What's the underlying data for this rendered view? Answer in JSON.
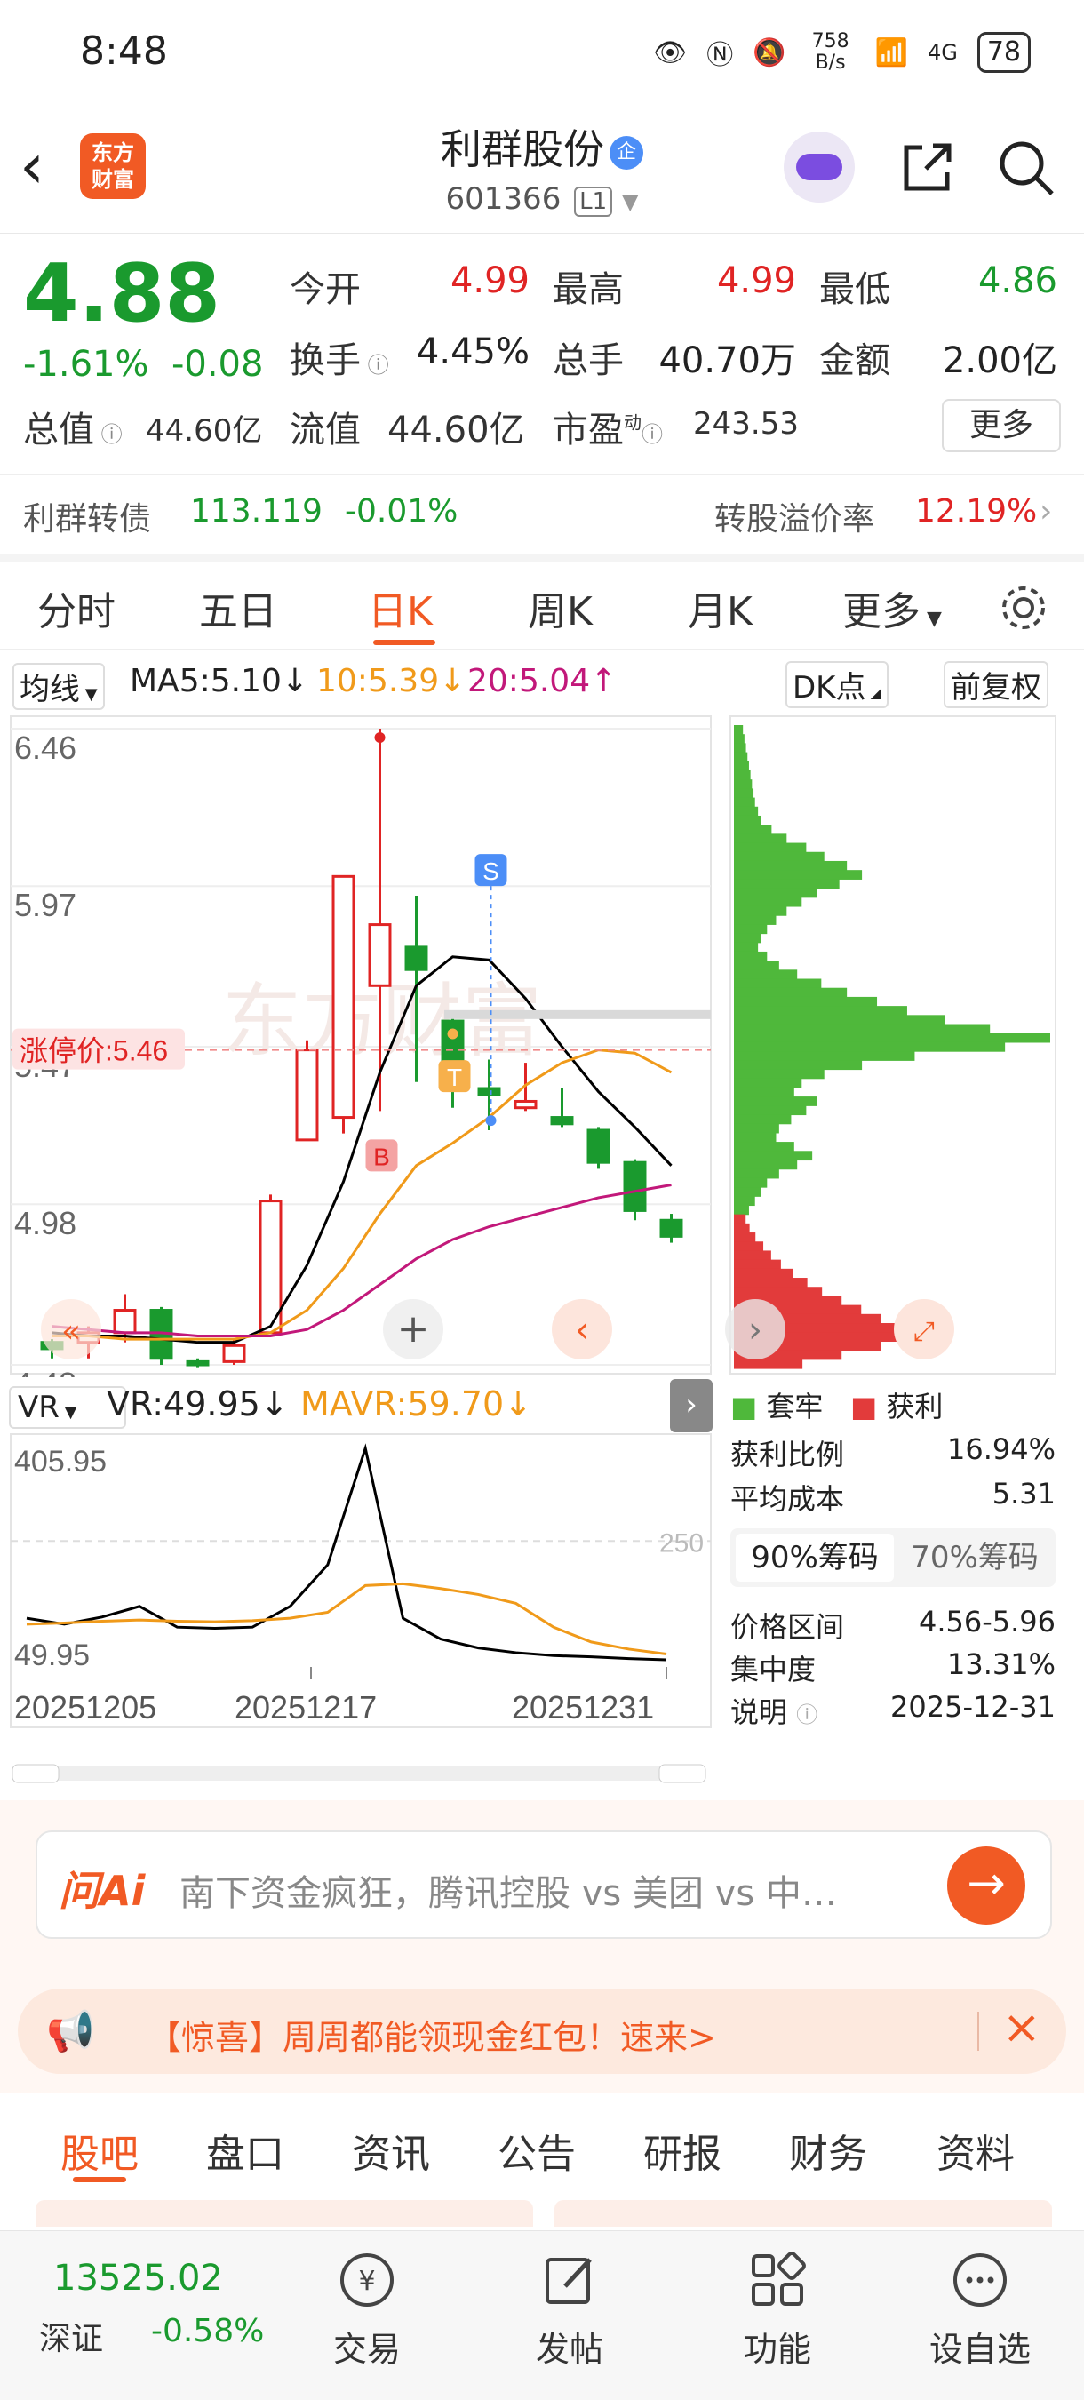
{
  "status_bar": {
    "time": "8:48",
    "net_speed": "758 B/s",
    "signal": "4G",
    "battery": "78"
  },
  "header": {
    "logo_line1": "东方",
    "logo_line2": "财富",
    "stock_name": "利群股份",
    "badge": "企",
    "stock_code": "601366",
    "level_tag": "L1"
  },
  "quote": {
    "price": "4.88",
    "change_pct": "-1.61%",
    "change": "-0.08",
    "open_label": "今开",
    "open": "4.99",
    "high_label": "最高",
    "high": "4.99",
    "low_label": "最低",
    "low": "4.86",
    "turnover_label": "换手",
    "turnover": "4.45%",
    "volume_label": "总手",
    "volume": "40.70万",
    "amount_label": "金额",
    "amount": "2.00亿",
    "mktcap_label": "总值",
    "mktcap": "44.60亿",
    "float_label": "流值",
    "float_cap": "44.60亿",
    "pe_label": "市盈",
    "pe_sup": "动",
    "pe": "243.53",
    "more_label": "更多"
  },
  "bond": {
    "name": "利群转债",
    "price": "113.119",
    "change": "-0.01%",
    "premium_label": "转股溢价率",
    "premium": "12.19%"
  },
  "tabs": [
    "分时",
    "五日",
    "日K",
    "周K",
    "月K",
    "更多"
  ],
  "active_tab": "日K",
  "indicators": {
    "ma_selector": "均线",
    "ma5": "MA5:5.10↓",
    "ma10": "10:5.39↓",
    "ma20": "20:5.04↑",
    "dk_label": "DK点",
    "adjust_label": "前复权"
  },
  "chart_data": [
    {
      "type": "candlestick",
      "price_axis_ticks": [
        "6.46",
        "5.97",
        "5.47",
        "4.98",
        "4.48"
      ],
      "ylim": [
        4.48,
        6.46
      ],
      "limit_up_label": "涨停价:5.46",
      "limit_up_value": 5.46,
      "markers": [
        "B",
        "T",
        "S"
      ],
      "candles": [
        {
          "open": 4.55,
          "high": 4.56,
          "low": 4.5,
          "close": 4.53
        },
        {
          "open": 4.55,
          "high": 4.6,
          "low": 4.5,
          "close": 4.58
        },
        {
          "open": 4.58,
          "high": 4.7,
          "low": 4.55,
          "close": 4.65
        },
        {
          "open": 4.65,
          "high": 4.66,
          "low": 4.48,
          "close": 4.5
        },
        {
          "open": 4.49,
          "high": 4.5,
          "low": 4.47,
          "close": 4.48
        },
        {
          "open": 4.49,
          "high": 4.56,
          "low": 4.48,
          "close": 4.54
        },
        {
          "open": 4.58,
          "high": 5.01,
          "low": 4.58,
          "close": 4.99
        },
        {
          "open": 5.18,
          "high": 5.49,
          "low": 5.18,
          "close": 5.46
        },
        {
          "open": 5.25,
          "high": 6.0,
          "low": 5.2,
          "close": 6.0
        },
        {
          "open": 5.66,
          "high": 6.46,
          "low": 5.27,
          "close": 5.85
        },
        {
          "open": 5.78,
          "high": 5.94,
          "low": 5.36,
          "close": 5.71
        },
        {
          "open": 5.55,
          "high": 5.57,
          "low": 5.28,
          "close": 5.37
        },
        {
          "open": 5.34,
          "high": 5.43,
          "low": 5.21,
          "close": 5.32
        },
        {
          "open": 5.28,
          "high": 5.42,
          "low": 5.27,
          "close": 5.3
        },
        {
          "open": 5.25,
          "high": 5.34,
          "low": 5.22,
          "close": 5.23
        },
        {
          "open": 5.21,
          "high": 5.22,
          "low": 5.09,
          "close": 5.11
        },
        {
          "open": 5.11,
          "high": 5.12,
          "low": 4.93,
          "close": 4.96
        },
        {
          "open": 4.93,
          "high": 4.95,
          "low": 4.86,
          "close": 4.88
        }
      ],
      "series": [
        {
          "name": "MA5",
          "color": "#000000",
          "values": [
            4.58,
            4.57,
            4.57,
            4.56,
            4.55,
            4.55,
            4.6,
            4.79,
            5.05,
            5.39,
            5.66,
            5.75,
            5.74,
            5.62,
            5.47,
            5.33,
            5.22,
            5.1
          ]
        },
        {
          "name": "10",
          "color": "#f09a1a",
          "values": [
            4.57,
            4.57,
            4.56,
            4.56,
            4.56,
            4.56,
            4.58,
            4.65,
            4.78,
            4.95,
            5.1,
            5.17,
            5.25,
            5.35,
            5.42,
            5.46,
            5.45,
            5.39
          ]
        },
        {
          "name": "20",
          "color": "#c2187a",
          "values": [
            4.6,
            4.59,
            4.58,
            4.58,
            4.57,
            4.57,
            4.57,
            4.59,
            4.65,
            4.73,
            4.81,
            4.87,
            4.91,
            4.94,
            4.97,
            5.0,
            5.02,
            5.04
          ]
        }
      ]
    },
    {
      "type": "line",
      "ylim": [
        49.95,
        405.95
      ],
      "yticks": [
        "405.95",
        "49.95"
      ],
      "reference_label": "250",
      "x_ticks": [
        "20251205",
        "20251217",
        "20251231"
      ],
      "series": [
        {
          "name": "VR:49.95↓",
          "color": "#000000",
          "values": [
            120,
            110,
            122,
            140,
            105,
            103,
            105,
            140,
            210,
            405.95,
            120,
            85,
            70,
            62,
            57,
            55,
            52,
            49.95
          ]
        },
        {
          "name": "MAVR:59.70↓",
          "color": "#f09a1a",
          "values": [
            110,
            112,
            115,
            117,
            115,
            114,
            116,
            120,
            130,
            175,
            178,
            170,
            160,
            145,
            105,
            80,
            68,
            59.7
          ]
        }
      ]
    },
    {
      "type": "bar",
      "orientation": "horizontal",
      "series": [
        {
          "name": "套牢",
          "color": "#4fb83b",
          "values": [
            6,
            7,
            8,
            9,
            10,
            11,
            12,
            13,
            14,
            16,
            18,
            25,
            35,
            48,
            60,
            75,
            85,
            70,
            55,
            45,
            35,
            28,
            22,
            18,
            16,
            22,
            30,
            42,
            58,
            75,
            95,
            115,
            140,
            170,
            210,
            180,
            120,
            85,
            60,
            45,
            40,
            55,
            48,
            38,
            30,
            28,
            40,
            52,
            42,
            30,
            22,
            18,
            14,
            10
          ]
        },
        {
          "name": "获利",
          "color": "#e23b3b",
          "values": [
            12,
            16,
            22,
            30,
            38,
            48,
            60,
            75,
            90,
            110,
            130,
            150,
            165,
            172,
            150,
            110,
            70
          ]
        }
      ]
    }
  ],
  "vr_panel": {
    "selector": "VR",
    "vr": "VR:49.95↓",
    "mavr": "MAVR:59.70↓"
  },
  "chip_panel": {
    "legend_trapped": "套牢",
    "legend_profit": "获利",
    "rows": [
      {
        "label": "获利比例",
        "value": "16.94%"
      },
      {
        "label": "平均成本",
        "value": "5.31"
      }
    ],
    "tab_90": "90%筹码",
    "tab_70": "70%筹码",
    "rows2": [
      {
        "label": "价格区间",
        "value": "4.56-5.96"
      },
      {
        "label": "集中度",
        "value": "13.31%"
      },
      {
        "label": "说明",
        "value": "2025-12-31"
      }
    ]
  },
  "ask": {
    "brand": "问Ai",
    "placeholder": "南下资金疯狂，腾讯控股 vs 美团 vs 中…"
  },
  "banner": {
    "text": "【惊喜】周周都能领现金红包！速来>"
  },
  "bottom_tabs": [
    "股吧",
    "盘口",
    "资讯",
    "公告",
    "研报",
    "财务",
    "资料"
  ],
  "nav": {
    "index_value": "13525.02",
    "index_name": "深证",
    "index_change": "-0.58%",
    "items": [
      "交易",
      "发帖",
      "功能",
      "设自选"
    ]
  },
  "colors": {
    "up": "#e02424",
    "down": "#1a9a2e",
    "accent": "#f15a24"
  }
}
